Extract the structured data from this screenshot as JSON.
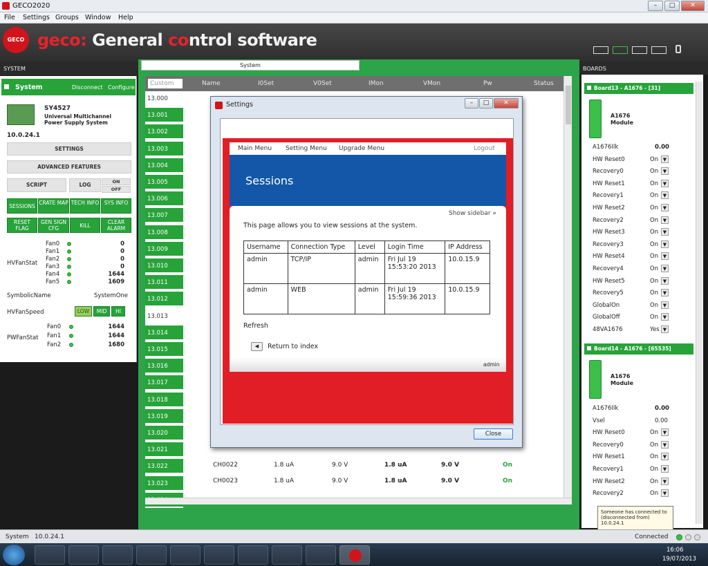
{
  "window": {
    "title": "GECO2020",
    "min": "–",
    "max": "□",
    "close": "✕"
  },
  "menu": [
    "File",
    "Settings",
    "Groups",
    "Window",
    "Help"
  ],
  "header": {
    "brand_red1": "geco: ",
    "brand_white1": "Ge",
    "brand_white2": "neral ",
    "brand_red2": "co",
    "brand_white3": "ntrol software",
    "logo": "GECO 2020"
  },
  "sections": {
    "system": "SYSTEM",
    "boards": "BOARDS",
    "tab_system": "System"
  },
  "left": {
    "system_label": "System",
    "disconnect": "Disconnect",
    "configure": "Configure",
    "model": "SY4527",
    "desc1": "Universal Multichannel",
    "desc2": "Power Supply System",
    "ip": "10.0.24.1",
    "settings": "SETTINGS",
    "advanced": "ADVANCED FEATURES",
    "script": "SCRIPT",
    "log": "LOG",
    "on": "ON",
    "off": "OFF",
    "buttons_row1": [
      "SESSIONS",
      "CRATE MAP",
      "TECH INFO",
      "SYS INFO"
    ],
    "buttons_row2": [
      "RESET FLAG",
      "GEN SIGN CFG",
      "KILL",
      "CLEAR ALARM"
    ],
    "hvfanstat_label": "HVFanStat",
    "hvfans": [
      {
        "name": "Fan0",
        "val": "0"
      },
      {
        "name": "Fan1",
        "val": "0"
      },
      {
        "name": "Fan2",
        "val": "0"
      },
      {
        "name": "Fan3",
        "val": "0"
      },
      {
        "name": "Fan4",
        "val": "1644"
      },
      {
        "name": "Fan5",
        "val": "1609"
      }
    ],
    "symbolic_label": "SymbolicName",
    "symbolic_val": "SystemOne",
    "hvfanspeed_label": "HVFanSpeed",
    "speed": [
      "LOW",
      "MID",
      "HI"
    ],
    "pwfanstat_label": "PWFanStat",
    "pwfans": [
      {
        "name": "Fan0",
        "val": "1644"
      },
      {
        "name": "Fan1",
        "val": "1644"
      },
      {
        "name": "Fan2",
        "val": "1680"
      }
    ]
  },
  "table": {
    "headers": [
      "Custom",
      "Name",
      "I0Set",
      "V0Set",
      "IMon",
      "VMon",
      "Pw",
      "Status"
    ],
    "rows": [
      "13.000",
      "13.001",
      "13.002",
      "13.003",
      "13.004",
      "13.005",
      "13.006",
      "13.007",
      "13.008",
      "13.009",
      "13.010",
      "13.011",
      "13.012",
      "13.013",
      "13.014",
      "13.015",
      "13.016",
      "13.017",
      "13.018",
      "13.019",
      "13.020",
      "13.021",
      "13.022",
      "13.023",
      "13.024"
    ],
    "visible": [
      {
        "name": "CH0022",
        "i0set": "1.8 uA",
        "v0set": "9.0  V",
        "imon": "1.8 uA",
        "vmon": "9.0  V",
        "pw": "On"
      },
      {
        "name": "CH0023",
        "i0set": "1.8 uA",
        "v0set": "9.0  V",
        "imon": "1.8 uA",
        "vmon": "9.0  V",
        "pw": "On"
      }
    ]
  },
  "dialog": {
    "title": "Settings",
    "web_menu": [
      "Main Menu",
      "Setting Menu",
      "Upgrade Menu"
    ],
    "logout": "Logout",
    "heading": "Sessions",
    "show_sidebar": "Show sidebar »",
    "intro": "This page allows you to view sessions at the system.",
    "columns": [
      "Username",
      "Connection Type",
      "Level",
      "Login Time",
      "IP Address"
    ],
    "sessions": [
      {
        "user": "admin",
        "type": "TCP/IP",
        "level": "admin",
        "time1": "Fri Jul 19",
        "time2": "15:53:20 2013",
        "ip": "10.0.15.9"
      },
      {
        "user": "admin",
        "type": "WEB",
        "level": "admin",
        "time1": "Fri Jul 19",
        "time2": "15:59:36 2013",
        "ip": "10.0.15.9"
      }
    ],
    "refresh": "Refresh",
    "return": "Return to index",
    "footer_user": "admin",
    "close": "Close"
  },
  "boards": {
    "board1": {
      "title": "Board13 - A1676 - [31]",
      "model": "A1676",
      "kind": "Module",
      "params": [
        {
          "name": "A1676Ilk",
          "val": "0.00",
          "dd": false
        },
        {
          "name": "HW Reset0",
          "val": "On",
          "dd": true
        },
        {
          "name": "Recovery0",
          "val": "On",
          "dd": true
        },
        {
          "name": "HW Reset1",
          "val": "On",
          "dd": true
        },
        {
          "name": "Recovery1",
          "val": "On",
          "dd": true
        },
        {
          "name": "HW Reset2",
          "val": "On",
          "dd": true
        },
        {
          "name": "Recovery2",
          "val": "On",
          "dd": true
        },
        {
          "name": "HW Reset3",
          "val": "On",
          "dd": true
        },
        {
          "name": "Recovery3",
          "val": "On",
          "dd": true
        },
        {
          "name": "HW Reset4",
          "val": "On",
          "dd": true
        },
        {
          "name": "Recovery4",
          "val": "On",
          "dd": true
        },
        {
          "name": "HW Reset5",
          "val": "On",
          "dd": true
        },
        {
          "name": "Recovery5",
          "val": "On",
          "dd": true
        },
        {
          "name": "GlobalOn",
          "val": "On",
          "dd": true
        },
        {
          "name": "GlobalOff",
          "val": "On",
          "dd": true
        },
        {
          "name": "48VA1676",
          "val": "Yes",
          "dd": true
        }
      ]
    },
    "board2": {
      "title": "Board14 - A1676 - [65535]",
      "model": "A1676",
      "kind": "Module",
      "params": [
        {
          "name": "A1676Ilk",
          "val": "0.00",
          "dd": false
        },
        {
          "name": "Vsel",
          "val": "0.00",
          "dd": false
        },
        {
          "name": "HW Reset0",
          "val": "On",
          "dd": true
        },
        {
          "name": "Recovery0",
          "val": "On",
          "dd": true
        },
        {
          "name": "HW Reset1",
          "val": "On",
          "dd": true
        },
        {
          "name": "Recovery1",
          "val": "On",
          "dd": true
        },
        {
          "name": "HW Reset2",
          "val": "On",
          "dd": true
        },
        {
          "name": "Recovery2",
          "val": "On",
          "dd": true
        }
      ]
    }
  },
  "statusbar": {
    "label": "System",
    "ip": "10.0.24.1",
    "connected": "Connected"
  },
  "toast": {
    "line1": "Someone has connected to",
    "line2": "(disconnected from)",
    "line3": "10.0.24.1"
  },
  "taskbar": {
    "time": "16:06",
    "date": "19/07/2013"
  }
}
